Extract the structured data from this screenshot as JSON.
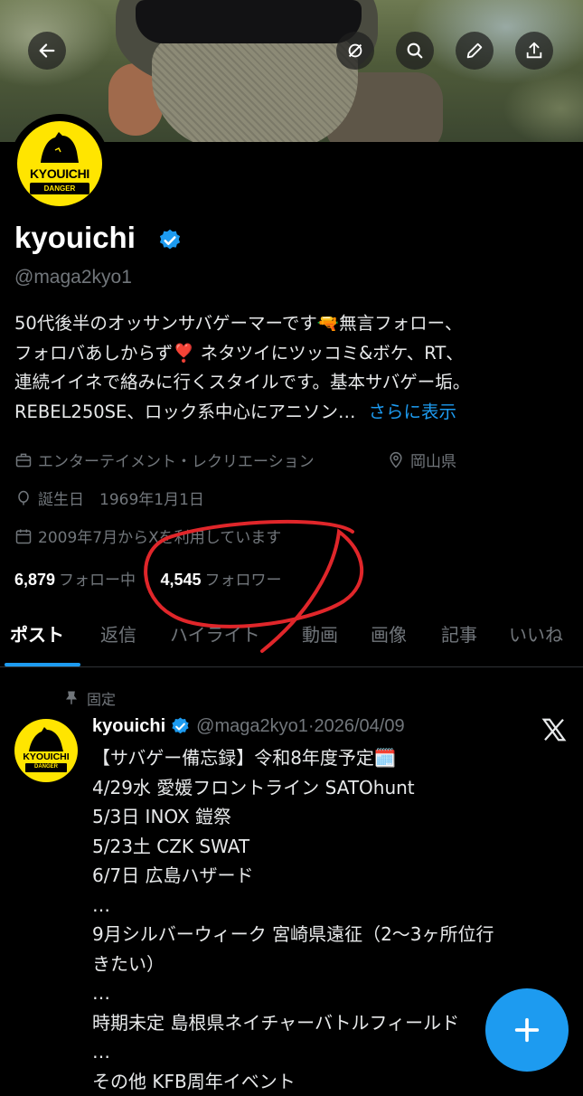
{
  "header": {
    "back_icon": "arrow-left-icon",
    "actions": [
      "grok-icon",
      "search-icon",
      "edit-icon",
      "share-icon"
    ]
  },
  "profile": {
    "display_name": "kyouichi",
    "verified": true,
    "handle": "@maga2kyo1",
    "avatar_logo_main": "KYOUICHI",
    "avatar_logo_sub": "DANGER",
    "bio_lines": [
      "50代後半のオッサンサバゲーマーです🔫無言フォロー、",
      "フォロバあしからず❣️ ネタツイにツッコミ&ボケ、RT、",
      "連続イイネで絡みに行くスタイルです。基本サバゲー垢。",
      "REBEL250SE、ロック系中心にアニソン…"
    ],
    "bio_more": "さらに表示",
    "category": "エンターテイメント・レクリエーション",
    "location": "岡山県",
    "birthday": "誕生日　1969年1月1日",
    "joined": "2009年7月からXを利用しています",
    "following_count": "6,879",
    "following_label": "フォロー中",
    "followers_count": "4,545",
    "followers_label": "フォロワー"
  },
  "tabs": [
    "ポスト",
    "返信",
    "ハイライト",
    "動画",
    "画像",
    "記事",
    "いいね"
  ],
  "pinned_post": {
    "pinned_label": "固定",
    "author": "kyouichi",
    "handle_date": "@maga2kyo1·2026/04/09",
    "lines": [
      "【サバゲー備忘録】令和8年度予定🗓️",
      "4/29水 愛媛フロントライン SATOhunt",
      "5/3日 INOX 鎧祭",
      "5/23土 CZK SWAT",
      "6/7日 広島ハザード",
      "…",
      "9月シルバーウィーク 宮崎県遠征（2〜3ヶ所位行",
      "きたい）",
      "…",
      "時期未定 島根県ネイチャーバトルフィールド",
      "…",
      "その他 KFB周年イベント"
    ]
  },
  "colors": {
    "accent": "#1d9bf0",
    "annotation": "#e0262a",
    "logo_yellow": "#ffe500"
  },
  "fab_icon": "plus-icon"
}
